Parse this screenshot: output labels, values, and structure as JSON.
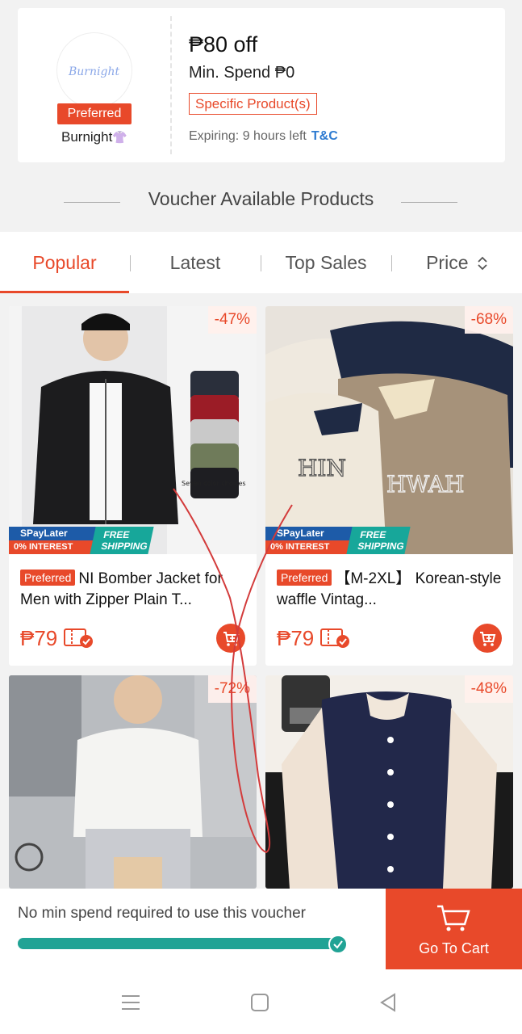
{
  "voucher": {
    "shop_logo_text": "Burnight",
    "preferred_label": "Preferred",
    "shop_name": "Burnight",
    "shop_emoji": "👚",
    "title": "₱80 off",
    "min_spend": "Min. Spend ₱0",
    "tag": "Specific Product(s)",
    "expiry": "Expiring: 9 hours left",
    "tc_label": "T&C"
  },
  "section": {
    "title": "Voucher Available Products"
  },
  "tabs": [
    {
      "label": "Popular",
      "active": true
    },
    {
      "label": "Latest",
      "active": false
    },
    {
      "label": "Top Sales",
      "active": false
    },
    {
      "label": "Price",
      "active": false
    }
  ],
  "products": [
    {
      "discount": "-47%",
      "preferred": "Preferred",
      "name": "NI Bomber Jacket for Men with Zipper Plain T...",
      "price": "₱79",
      "promo_spaylater": "SPayLater",
      "promo_interest": "0% INTEREST",
      "promo_shipping": "FREE SHIPPING",
      "image_caption": "Seven color choices"
    },
    {
      "discount": "-68%",
      "preferred": "Preferred",
      "name": "【M-2XL】 Korean-style waffle Vintag...",
      "price": "₱79",
      "promo_spaylater": "SPayLater",
      "promo_interest": "0% INTEREST",
      "promo_shipping": "FREE SHIPPING"
    },
    {
      "discount": "-72%"
    },
    {
      "discount": "-48%"
    }
  ],
  "bottom": {
    "message": "No min spend required to use this voucher",
    "progress": 1.0,
    "cart_label": "Go To Cart"
  },
  "colors": {
    "accent": "#e8492a",
    "progress": "#21a395",
    "link": "#2e7bd1"
  },
  "icons": [
    "cart-icon",
    "coupon-icon",
    "sort-icon",
    "check-icon",
    "menu-icon",
    "home-icon",
    "back-icon"
  ]
}
